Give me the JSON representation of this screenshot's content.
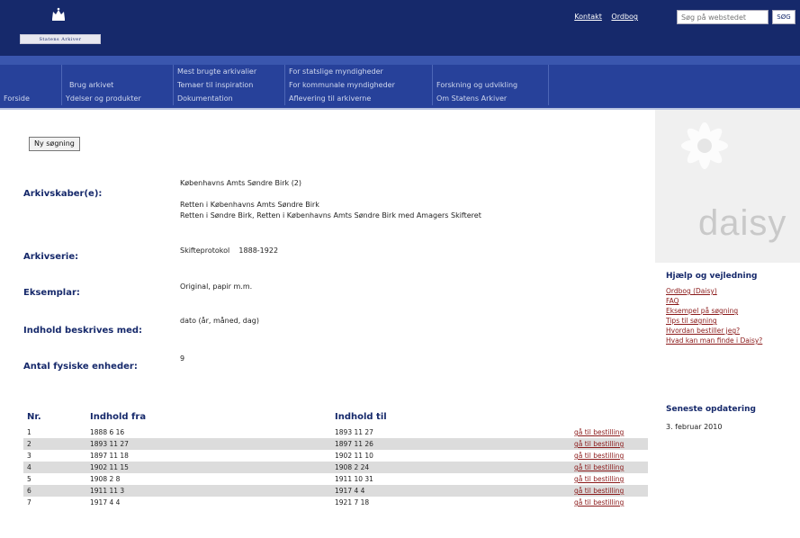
{
  "header": {
    "logo_text": "Statens Arkiver",
    "top_links": [
      "Kontakt",
      "Ordbog"
    ],
    "search_placeholder": "Søg på webstedet",
    "search_button": "SØG"
  },
  "nav": {
    "columns": [
      [
        "",
        "",
        "Forside"
      ],
      [
        "",
        "Brug arkivet",
        "Ydelser og produkter"
      ],
      [
        "Mest brugte arkivalier",
        "Temaer til inspiration",
        "Dokumentation"
      ],
      [
        "For statslige myndigheder",
        "For kommunale myndigheder",
        "Aflevering til arkiverne"
      ],
      [
        "",
        "Forskning og udvikling",
        "Om Statens Arkiver"
      ]
    ]
  },
  "main": {
    "new_search_label": "Ny søgning",
    "fields": {
      "archive_creator": {
        "label": "Arkivskaber(e):",
        "lines": [
          "Københavns Amts Søndre Birk (2)",
          "",
          "Retten i Københavns Amts Søndre Birk",
          "Retten i Søndre Birk, Retten i Københavns Amts Søndre Birk med Amagers Skifteret"
        ]
      },
      "archive_series": {
        "label": "Arkivserie:",
        "value": "Skifteprotokol    1888-1922"
      },
      "copy": {
        "label": "Eksemplar:",
        "value": "Original, papir m.m."
      },
      "content_described": {
        "label": "Indhold beskrives med:",
        "value": "dato (år, måned, dag)"
      },
      "physical_units": {
        "label": "Antal fysiske enheder:",
        "value": "9"
      }
    },
    "table": {
      "headers": {
        "nr": "Nr.",
        "from": "Indhold fra",
        "to": "Indhold til"
      },
      "link_label": "gå til bestilling",
      "rows": [
        {
          "nr": "1",
          "from": "1888 6 16",
          "to": "1893 11 27"
        },
        {
          "nr": "2",
          "from": "1893 11 27",
          "to": "1897 11 26"
        },
        {
          "nr": "3",
          "from": "1897 11 18",
          "to": "1902 11 10"
        },
        {
          "nr": "4",
          "from": "1902 11 15",
          "to": "1908 2 24"
        },
        {
          "nr": "5",
          "from": "1908 2 8",
          "to": "1911 10 31"
        },
        {
          "nr": "6",
          "from": "1911 11 3",
          "to": "1917 4 4"
        },
        {
          "nr": "7",
          "from": "1917 4 4",
          "to": "1921 7 18"
        }
      ]
    }
  },
  "sidebar": {
    "logo_text": "daisy",
    "help_heading": "Hjælp og vejledning",
    "help_links": [
      "Ordbog (Daisy)",
      "FAQ",
      "Eksempel på søgning",
      "Tips til søgning",
      "Hvordan bestiller jeg?",
      "Hvad kan man finde i Daisy?"
    ],
    "update_heading": "Seneste opdatering",
    "update_date": "3. februar 2010"
  },
  "colors": {
    "header_bg": "#16296b",
    "nav_bg": "#27419a",
    "link_red": "#8b1a1a",
    "label_blue": "#16296b",
    "row_alt": "#dcdcdc"
  }
}
